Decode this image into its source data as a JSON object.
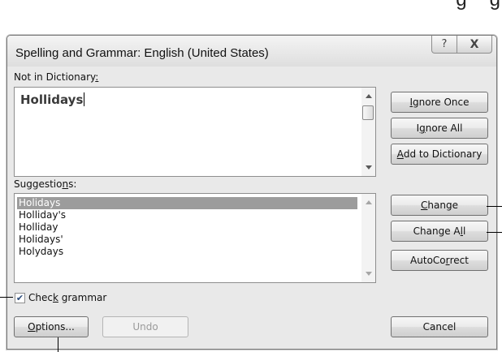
{
  "page_fragment": {
    "left_text": "g",
    "right_text": "g"
  },
  "window": {
    "title": "Spelling and Grammar: English (United States)",
    "help_glyph": "?",
    "close_glyph": "X"
  },
  "not_in_dictionary": {
    "label_pre": "Not in Dictionary",
    "label_key": ":",
    "text": "Hollidays"
  },
  "suggestions": {
    "label_pre": "Suggestio",
    "label_key": "n",
    "label_post": "s:",
    "items": [
      "Holidays",
      "Holliday's",
      "Holliday",
      "Holidays'",
      "Holydays"
    ],
    "selected_index": 0
  },
  "check_grammar": {
    "checked": true,
    "label_pre": "Chec",
    "label_key": "k",
    "label_post": " grammar"
  },
  "buttons": {
    "ignore_once": {
      "pre": "",
      "key": "I",
      "post": "gnore Once"
    },
    "ignore_all": {
      "pre": "I",
      "key": "g",
      "post": "nore All"
    },
    "add_to_dictionary": {
      "pre": "",
      "key": "A",
      "post": "dd to Dictionary"
    },
    "change": {
      "pre": "",
      "key": "C",
      "post": "hange"
    },
    "change_all": {
      "pre": "Change A",
      "key": "l",
      "post": "l"
    },
    "autocorrect": {
      "pre": "AutoCo",
      "key": "r",
      "post": "rect"
    },
    "options": {
      "pre": "",
      "key": "O",
      "post": "ptions..."
    },
    "undo": {
      "label": "Undo"
    },
    "cancel": {
      "label": "Cancel"
    }
  }
}
